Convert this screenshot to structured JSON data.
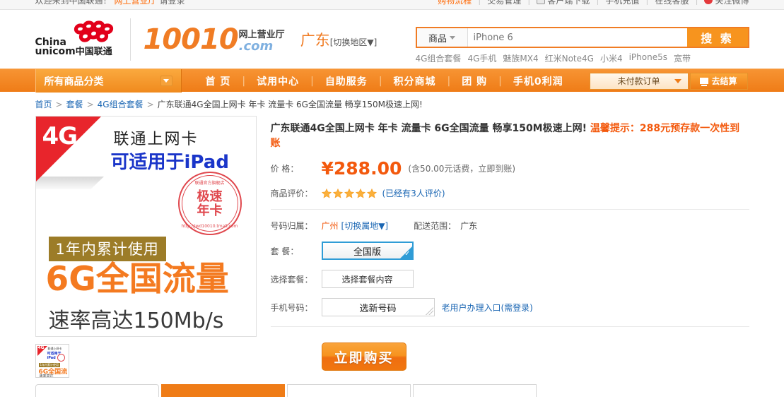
{
  "topbar": {
    "left_text": "欢迎来到中国联通！",
    "left_link": "网上营业厅",
    "left_tail": "请登录",
    "right_items": [
      {
        "label": "购物流程",
        "icon": "none",
        "highlight": true
      },
      {
        "label": "交易管理",
        "icon": "none",
        "highlight": false
      },
      {
        "label": "客户端下载",
        "icon": "phone-icon",
        "highlight": false
      },
      {
        "label": "手机充值",
        "icon": "none",
        "highlight": false
      },
      {
        "label": "在线客服",
        "icon": "none",
        "highlight": false
      },
      {
        "label": "关注微博",
        "icon": "weibo-icon",
        "highlight": false
      }
    ]
  },
  "header": {
    "logo_en_line1": "China",
    "logo_en_line2": "unicom",
    "logo_cn": "中国联通",
    "brand_number": "10010",
    "brand_cn": "网上营业厅",
    "brand_dot": ".com",
    "region_name": "广东",
    "region_switch": "[切换地区▼]"
  },
  "search": {
    "category_label": "商品",
    "placeholder": "iPhone 6",
    "value": "",
    "button_label": "搜 索",
    "hot_words": [
      "4G组合套餐",
      "4G手机",
      "魅族MX4",
      "红米Note4G",
      "小米4",
      "iPhone5s",
      "宽带"
    ]
  },
  "nav": {
    "all_categories": "所有商品分类",
    "links": [
      "首  页",
      "试用中心",
      "自助服务",
      "积分商城",
      "团  购",
      "手机0利润"
    ],
    "unpaid_orders": "未付款订单",
    "checkout": "去结算"
  },
  "breadcrumb": [
    {
      "label": "首页",
      "link": true
    },
    {
      "label": "套餐",
      "link": true
    },
    {
      "label": "4G组合套餐",
      "link": true
    },
    {
      "label": "广东联通4G全国上网卡 年卡 流量卡 6G全国流量 畅享150M极速上网!",
      "link": false
    }
  ],
  "product_image": {
    "badge_4g": "4G",
    "line1": "联通上网卡",
    "line2": "可适用于iPad",
    "stamp_top": "联通官方旗舰店",
    "stamp_main_l1": "极速",
    "stamp_main_l2": "年卡",
    "stamp_bottom": "http://jwd10010.tmall.com",
    "band": "1年内累计使用",
    "headline": "6G全国流量",
    "speed": "速率高达150Mb/s"
  },
  "product": {
    "title": "广东联通4G全国上网卡 年卡 流量卡 6G全国流量 畅享150M极速上网!",
    "title_tip": "温馨提示：288元预存款一次性到账",
    "price_label": "价    格：",
    "price": "¥288.00",
    "price_note": "(含50.00元话费，立即到账)",
    "rating_label": "商品评价：",
    "rating_stars": 5,
    "rating_text": "(已经有3人评价)",
    "attribution_label": "号码归属：",
    "attribution_value": "广州",
    "attribution_switch": "[切换属地▼]",
    "shipping_label": "配送范围：",
    "shipping_value": "广东",
    "package_label": "套    餐：",
    "package_selected": "全国版",
    "choose_package_label": "选择套餐：",
    "choose_package_button": "选择套餐内容",
    "phone_label": "手机号码：",
    "phone_button": "选新号码",
    "old_user_link": "老用户办理入口(需登录)",
    "buy_button": "立即购买"
  },
  "bottom_tabs": [
    {
      "label": "",
      "active": false,
      "shape": "round"
    },
    {
      "label": "",
      "active": true,
      "shape": "square"
    },
    {
      "label": "",
      "active": false,
      "shape": "square"
    },
    {
      "label": "",
      "active": false,
      "shape": "square"
    }
  ],
  "colors": {
    "brand_orange": "#f07c24",
    "price_red": "#f3590d",
    "link_blue": "#1a66b3",
    "select_blue": "#2f9cd6"
  }
}
